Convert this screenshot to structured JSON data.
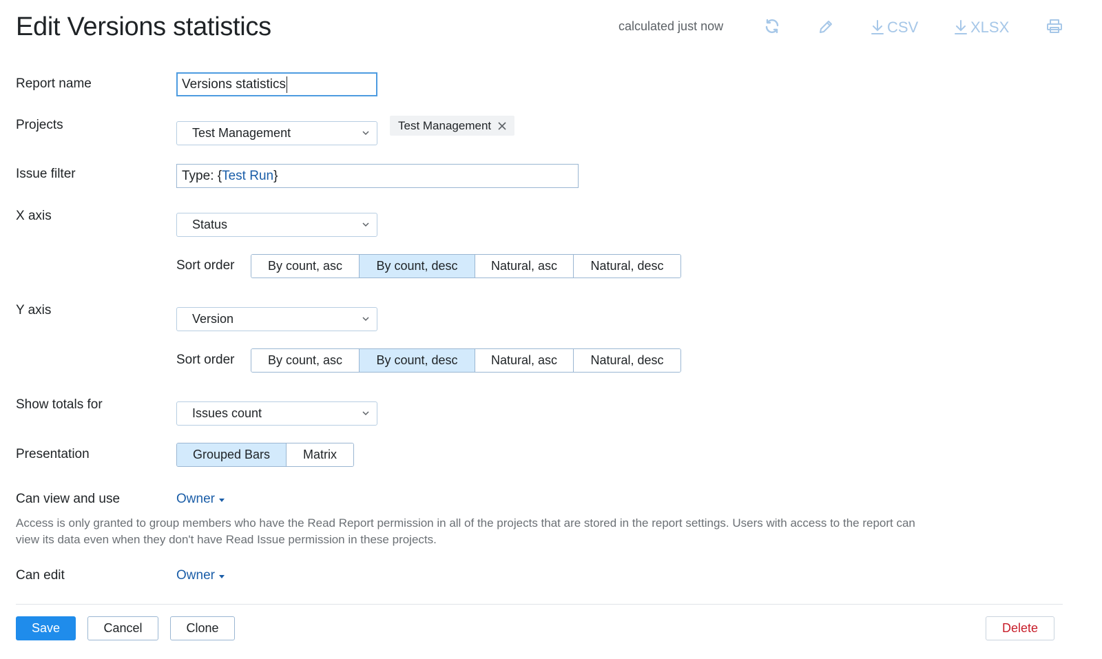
{
  "header": {
    "title": "Edit Versions statistics",
    "calculated": "calculated just now",
    "csv_label": "CSV",
    "xlsx_label": "XLSX",
    "icons": [
      "refresh-icon",
      "pencil-icon",
      "download-icon",
      "print-icon"
    ]
  },
  "form": {
    "report_name": {
      "label": "Report name",
      "value": "Versions statistics"
    },
    "projects": {
      "label": "Projects",
      "selected": "Test Management",
      "tag": "Test Management"
    },
    "issue_filter": {
      "label": "Issue filter",
      "prefix": "Type: {",
      "token": "Test Run",
      "suffix": "}"
    },
    "x_axis": {
      "label": "X axis",
      "selected": "Status",
      "sort_label": "Sort order",
      "options": [
        "By count, asc",
        "By count, desc",
        "Natural, asc",
        "Natural, desc"
      ],
      "active": "By count, desc"
    },
    "y_axis": {
      "label": "Y axis",
      "selected": "Version",
      "sort_label": "Sort order",
      "options": [
        "By count, asc",
        "By count, desc",
        "Natural, asc",
        "Natural, desc"
      ],
      "active": "By count, desc"
    },
    "show_totals": {
      "label": "Show totals for",
      "selected": "Issues count"
    },
    "presentation": {
      "label": "Presentation",
      "options": [
        "Grouped Bars",
        "Matrix"
      ],
      "active": "Grouped Bars"
    },
    "can_view": {
      "label": "Can view and use",
      "value": "Owner"
    },
    "access_note": "Access is only granted to group members who have the Read Report permission in all of the projects that are stored in the report settings. Users with access to the report can view its data even when they don't have Read Issue permission in these projects.",
    "can_edit": {
      "label": "Can edit",
      "value": "Owner"
    }
  },
  "footer": {
    "save": "Save",
    "cancel": "Cancel",
    "clone": "Clone",
    "delete": "Delete"
  },
  "colors": {
    "primary": "#1f8ceb",
    "active_segment": "#d3eafc",
    "link": "#1b5ea8",
    "danger": "#c81e2a",
    "toolbar_icon": "#a6c7e8"
  }
}
